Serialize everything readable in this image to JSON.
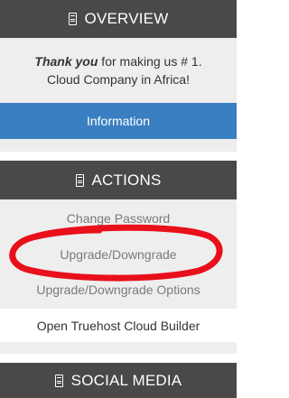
{
  "overview": {
    "title": "OVERVIEW",
    "thanks_emphasis": "Thank you",
    "thanks_rest_line1": " for making us # 1.",
    "thanks_line2": "Cloud Company in Africa!",
    "info_button": "Information"
  },
  "actions": {
    "title": "ACTIONS",
    "items": [
      {
        "label": "Change Password"
      },
      {
        "label": "Upgrade/Downgrade"
      },
      {
        "label": "Upgrade/Downgrade Options"
      }
    ],
    "builder_link": "Open Truehost Cloud Builder"
  },
  "social": {
    "title": "SOCIAL MEDIA"
  },
  "colors": {
    "header_bg": "#4a4849",
    "panel_bg": "#eeeeee",
    "info_button_bg": "#3a7fc1",
    "annotation_stroke": "#e8101a"
  },
  "icons": {
    "header_icon": "document-icon"
  }
}
